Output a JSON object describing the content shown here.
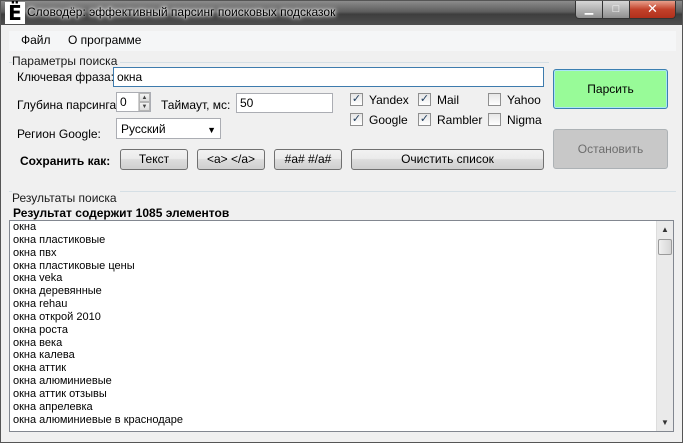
{
  "window": {
    "app_icon": "Ё",
    "title": "Словодёр: эффективный парсинг поисковых подсказок",
    "min_glyph": "▁",
    "max_glyph": "□",
    "close_glyph": "✕"
  },
  "menu": {
    "file": "Файл",
    "about": "О программе"
  },
  "params": {
    "group_label": "Параметры поиска",
    "key_phrase_label": "Ключевая фраза:",
    "key_phrase_value": "окна",
    "depth_label": "Глубина парсинга:",
    "depth_value": "0",
    "timeout_label": "Таймаут, мс:",
    "timeout_value": "50",
    "region_label": "Регион Google:",
    "region_value": "Русский",
    "engines": {
      "yandex": {
        "label": "Yandex",
        "checked": true
      },
      "mail": {
        "label": "Mail",
        "checked": true
      },
      "yahoo": {
        "label": "Yahoo",
        "checked": false
      },
      "google": {
        "label": "Google",
        "checked": true
      },
      "rambler": {
        "label": "Rambler",
        "checked": true
      },
      "nigma": {
        "label": "Nigma",
        "checked": false
      }
    },
    "save_as_label": "Сохранить как:",
    "save_text": "Текст",
    "save_links": "<a> </a>",
    "save_hash": "#a# #/a#",
    "clear_list": "Очистить список",
    "start": "Парсить",
    "stop": "Остановить"
  },
  "results": {
    "group_label": "Результаты поиска",
    "count_text": "Результат содержит 1085 элементов",
    "items": [
      "окна",
      "окна пластиковые",
      "окна пвх",
      "окна пластиковые цены",
      "окна veka",
      "окна деревянные",
      "окна rehau",
      "окна открой 2010",
      "окна роста",
      "окна века",
      "окна калева",
      "окна аттик",
      "окна алюминиевые",
      "окна аттик отзывы",
      "окна апрелевка",
      "окна алюминиевые в краснодаре"
    ]
  },
  "colors": {
    "start_button": "#98fb98",
    "stop_button": "#c8c8c8"
  }
}
